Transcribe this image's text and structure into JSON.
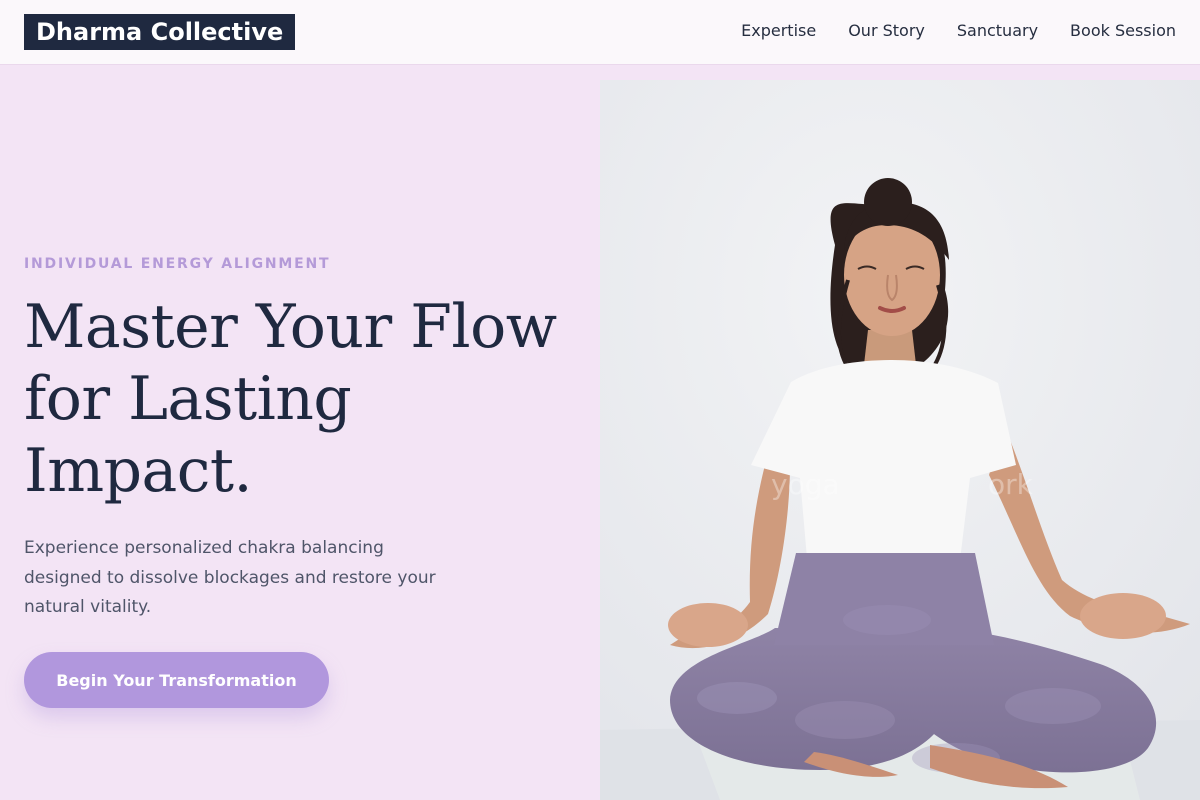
{
  "brand": {
    "name": "Dharma Collective"
  },
  "nav": {
    "links": [
      "Expertise",
      "Our Story",
      "Sanctuary",
      "Book Session"
    ]
  },
  "hero": {
    "eyebrow": "INDIVIDUAL ENERGY ALIGNMENT",
    "headline_lines": [
      "Master Your Flow",
      "for Lasting",
      "Impact."
    ],
    "body_lines": [
      "Experience personalized chakra balancing",
      "designed to dissolve blockages and restore your",
      "natural vitality."
    ],
    "cta_label": "Begin Your Transformation"
  },
  "photo": {
    "subject": "woman meditating in lotus pose on a yoga mat",
    "watermark": "yoga",
    "watermark_2": "ork"
  },
  "colors": {
    "page_background": "#f3e4f5",
    "nav_background": "#fbf8fb",
    "brand_badge": "#1f2940",
    "eyebrow": "#b49ad8",
    "headline": "#1f2940",
    "body": "#4f5569",
    "accent": "#b197dd"
  }
}
